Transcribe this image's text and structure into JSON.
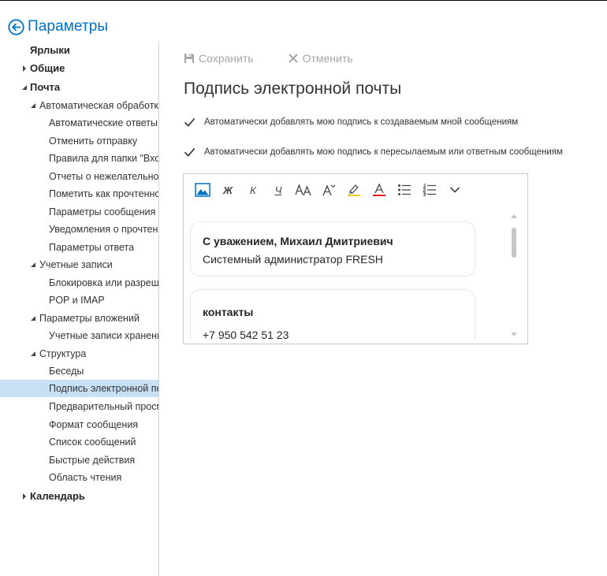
{
  "header": {
    "title": "Параметры",
    "back_icon": "back-arrow-circle-icon",
    "accent_color": "#0072c6"
  },
  "sidebar": {
    "selected_color": "#c7e0f4",
    "items": [
      {
        "label": "Ярлыки"
      },
      {
        "label": "Общие"
      },
      {
        "label": "Почта"
      },
      {
        "label": "Автоматическая обработка"
      },
      {
        "label": "Автоматические ответы"
      },
      {
        "label": "Отменить отправку"
      },
      {
        "label": "Правила для папки \"Входящие\""
      },
      {
        "label": "Отчеты о нежелательной почте"
      },
      {
        "label": "Пометить как прочтенное"
      },
      {
        "label": "Параметры сообщения"
      },
      {
        "label": "Уведомления о прочтении"
      },
      {
        "label": "Параметры ответа"
      },
      {
        "label": "Учетные записи"
      },
      {
        "label": "Блокировка или разрешение"
      },
      {
        "label": "POP и IMAP"
      },
      {
        "label": "Параметры вложений"
      },
      {
        "label": "Учетные записи хранения"
      },
      {
        "label": "Структура"
      },
      {
        "label": "Беседы"
      },
      {
        "label": "Подпись электронной почты"
      },
      {
        "label": "Предварительный просмотр"
      },
      {
        "label": "Формат сообщения"
      },
      {
        "label": "Список сообщений"
      },
      {
        "label": "Быстрые действия"
      },
      {
        "label": "Область чтения"
      },
      {
        "label": "Календарь"
      }
    ]
  },
  "toolbar": {
    "save_label": "Сохранить",
    "save_icon": "floppy-disk-icon",
    "cancel_label": "Отменить",
    "cancel_icon": "close-x-icon"
  },
  "main": {
    "title": "Подпись электронной почты",
    "options": [
      {
        "label": "Автоматически добавлять мою подпись к создаваемым мной сообщениям",
        "checked": true
      },
      {
        "label": "Автоматически добавлять мою подпись к пересылаемым или ответным сообщениям",
        "checked": true
      }
    ]
  },
  "editor": {
    "format_buttons": [
      {
        "name": "insert-image-icon"
      },
      {
        "name": "bold-icon",
        "glyph": "Ж"
      },
      {
        "name": "italic-icon",
        "glyph": "К"
      },
      {
        "name": "underline-icon",
        "glyph": "Ч"
      },
      {
        "name": "font-size-icon"
      },
      {
        "name": "increase-font-icon"
      },
      {
        "name": "highlight-icon",
        "color": "#f2c811"
      },
      {
        "name": "font-color-icon",
        "color": "#e81123"
      },
      {
        "name": "bullet-list-icon"
      },
      {
        "name": "numbered-list-icon"
      },
      {
        "name": "more-options-chevron-icon"
      }
    ],
    "signature": {
      "card1_name": "С уважением, Михаил Дмитриевич",
      "card1_role": "Системный администратор FRESH",
      "card2_heading": "контакты",
      "card2_phone": "+7 950 542 51 23"
    }
  }
}
